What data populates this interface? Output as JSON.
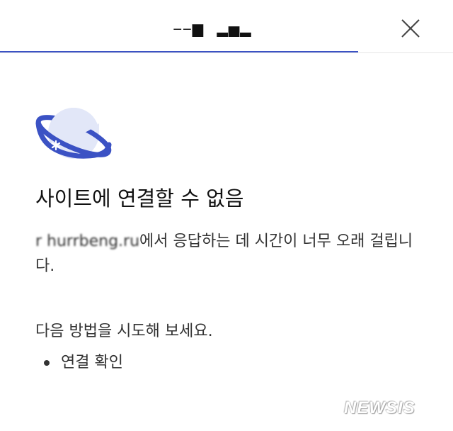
{
  "header": {
    "title": "‒‒▆  ▂▅▂",
    "progress_percent": 79
  },
  "colors": {
    "accent": "#3b52c4",
    "planet_fill": "#e2e7f8",
    "ring": "#3b52c4"
  },
  "icons": {
    "close": "close-icon",
    "planet": "planet-icon"
  },
  "error": {
    "title": "사이트에 연결할 수 없음",
    "site_host": "r hurrbeng.ru",
    "description_suffix": "에서 응답하는 데 시간이 너무 오래 걸립니다."
  },
  "suggestions": {
    "heading": "다음 방법을 시도해 보세요.",
    "items": [
      "연결 확인"
    ]
  },
  "watermark": "NEWSIS"
}
